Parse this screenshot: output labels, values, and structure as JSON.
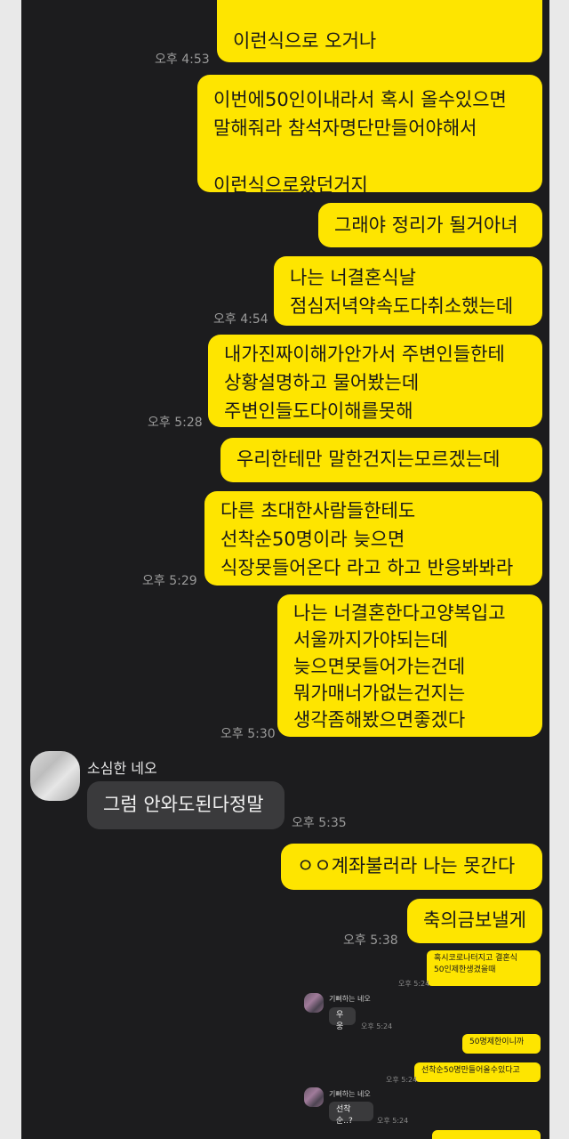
{
  "messages": {
    "m1": "이런식으로 오거나",
    "t1": "오후 4:53",
    "m2": "이번에50인이내라서 혹시 올수있으면\n말해줘라 참석자명단만들어야해서\n\n이런식으로왔던거지",
    "m3": "그래야 정리가 될거아녀",
    "m4": "나는 너결혼식날\n점심저녁약속도다취소했는데",
    "t4": "오후 4:54",
    "m5": "내가진짜이해가안가서 주변인들한테\n상황설명하고 물어봤는데\n주변인들도다이해를못해",
    "t5": "오후 5:28",
    "m6": "우리한테만 말한건지는모르겠는데",
    "m7": "다른 초대한사람들한테도\n선착순50명이라 늦으면\n식장못들어온다 라고 하고 반응봐봐라",
    "t7": "오후 5:29",
    "m8": "나는 너결혼한다고양복입고\n서울까지가야되는데\n늦으면못들어가는건데\n뭐가매너가없는건지는\n생각좀해봤으면좋겠다",
    "t8": "오후 5:30",
    "sender": "소심한 네오",
    "m9": "그럼 안와도된다정말",
    "t9": "오후 5:35",
    "m10": "ㅇㅇ계좌불러라 나는 못간다",
    "m11": "축의금보낼게",
    "t11": "오후 5:38"
  },
  "inset": {
    "a1": "혹시코로나터지고 결혼식\n50인제한생겼을때",
    "ta1": "오후 5:24",
    "sender": "기뻐하는 네오",
    "b1": "우웅",
    "tb1": "오후 5:24",
    "a2": "50명제한이니까",
    "a3": "선착순50명만들어올수있다고",
    "ta3": "오후 5:24",
    "b2": "선착순..?",
    "tb2": "오후 5:24"
  },
  "colors": {
    "outgoing": "#fee500",
    "incoming": "#3a3a3c",
    "background": "#1c1c1e"
  }
}
